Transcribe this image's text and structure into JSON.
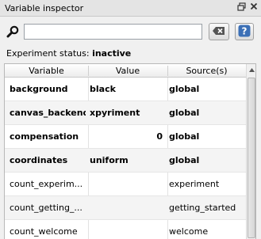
{
  "window": {
    "title": "Variable inspector",
    "float_icon": "restore-icon",
    "close_icon": "close-icon"
  },
  "search": {
    "value": "",
    "placeholder": "",
    "icon": "magnifier-icon",
    "clear_icon": "clear-icon",
    "help_icon": "help-icon"
  },
  "status": {
    "label": "Experiment status:",
    "value": "inactive"
  },
  "table": {
    "columns": [
      "Variable",
      "Value",
      "Source(s)"
    ],
    "rows": [
      {
        "variable": "background",
        "value": "black",
        "source": "global"
      },
      {
        "variable": "canvas_backend",
        "value": "xpyriment",
        "source": "global"
      },
      {
        "variable": "compensation",
        "value": "0",
        "source": "global"
      },
      {
        "variable": "coordinates",
        "value": "uniform",
        "source": "global"
      },
      {
        "variable": "count_experim...",
        "value": "",
        "source": "experiment"
      },
      {
        "variable": "count_getting_...",
        "value": "",
        "source": "getting_started"
      },
      {
        "variable": "count_welcome",
        "value": "",
        "source": "welcome"
      }
    ]
  },
  "colors": {
    "clear_button_icon": "#555555",
    "help_button_icon": "#3b6fb6"
  }
}
